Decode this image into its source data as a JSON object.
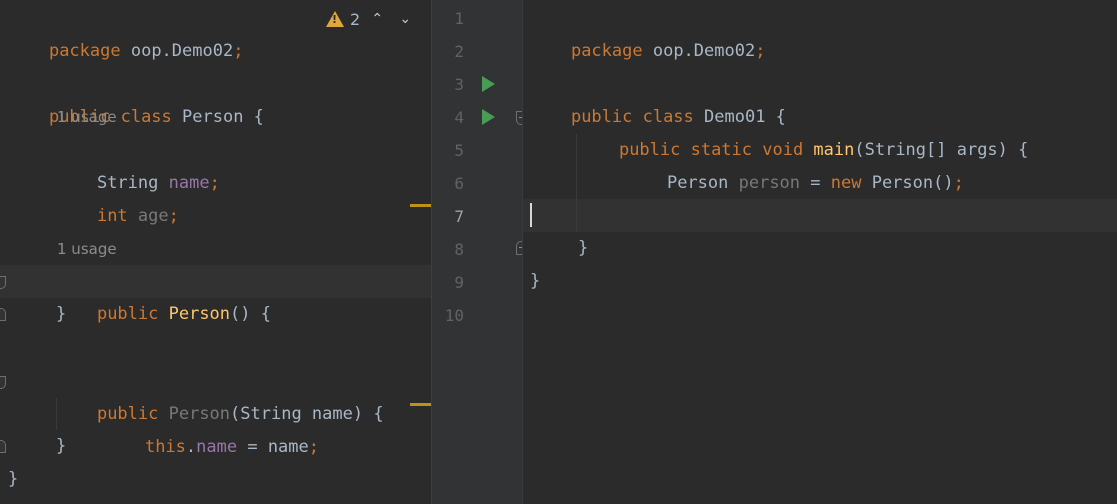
{
  "colors": {
    "background": "#2b2b2b",
    "gutter": "#313335",
    "keyword": "#cc7832",
    "field": "#9876aa",
    "method": "#ffc66d",
    "text": "#a9b7c6",
    "warning": "#e0a73c",
    "run": "#499c54"
  },
  "icons": {
    "warning": "warning-icon",
    "prev": "chevron-up-icon",
    "next": "chevron-down-icon",
    "run": "run-icon",
    "fold": "fold-icon"
  },
  "inspection": {
    "warnings": "2"
  },
  "left": {
    "line1": {
      "kw": "package",
      "rest": " oop.Demo02",
      "semi": ";"
    },
    "line3": {
      "kw": "public class",
      "name": " Person",
      "brace": " {"
    },
    "hint1": "1 usage",
    "line4": {
      "type": "String ",
      "field": "name",
      "semi": ";"
    },
    "line5": {
      "kw": "int",
      "field": " age",
      "semi": ";"
    },
    "hint2": "1 usage",
    "line7": {
      "kw": "public",
      "name": " Person",
      "rest": "() {"
    },
    "line8": "}",
    "line10": {
      "kw": "public",
      "name": " Person",
      "rest": "(String name) {"
    },
    "line11": {
      "kw": "this",
      "dot": ".",
      "field": "name",
      "rest": " = name",
      "semi": ";"
    },
    "line12": "}",
    "line13": "}"
  },
  "right": {
    "line_numbers": [
      "1",
      "2",
      "3",
      "4",
      "5",
      "6",
      "7",
      "8",
      "9",
      "10"
    ],
    "current_line": "7",
    "line1": {
      "kw": "package",
      "rest": " oop.Demo02",
      "semi": ";"
    },
    "line3": {
      "kw": "public class",
      "name": " Demo01",
      "brace": " {"
    },
    "line4": {
      "kw": "public static void",
      "method": " main",
      "rest": "(String[] args) {"
    },
    "line5": {
      "type": "Person ",
      "var": "person",
      "eq": " = ",
      "kw": "new",
      "rest": " Person()",
      "semi": ";"
    },
    "line8": "}",
    "line9": "}"
  }
}
